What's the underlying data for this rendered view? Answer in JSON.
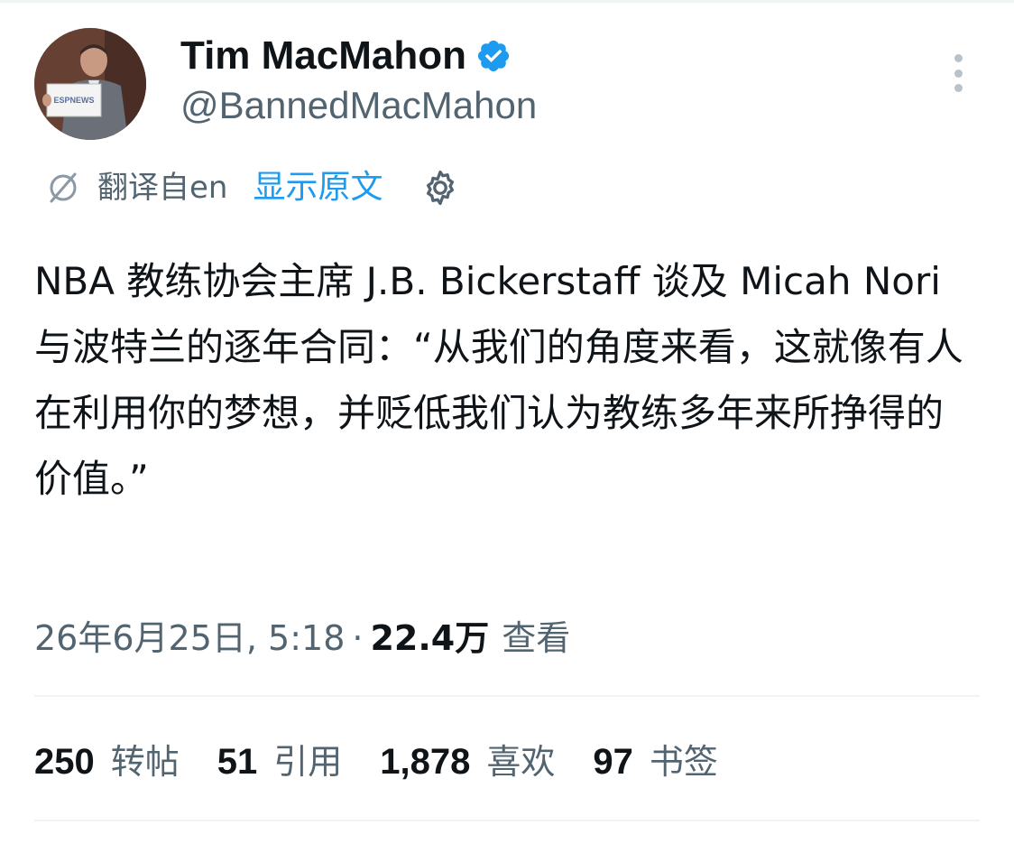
{
  "author": {
    "display_name": "Tim MacMahon",
    "handle": "@BannedMacMahon",
    "verified": true,
    "avatar_sign_text": "ESPNEWS"
  },
  "translation": {
    "label": "翻译自en",
    "show_original": "显示原文"
  },
  "tweet": {
    "text": "NBA 教练协会主席 J.B. Bickerstaff 谈及 Micah Nori 与波特兰的逐年合同：“从我们的角度来看，这就像有人在利用你的梦想，并贬低我们认为教练多年来所挣得的价值。”"
  },
  "meta": {
    "date": "26年6月25日, 5:18",
    "separator": "·",
    "views_count": "22.4万",
    "views_label": "查看"
  },
  "stats": [
    {
      "count": "250",
      "label": "转帖"
    },
    {
      "count": "51",
      "label": "引用"
    },
    {
      "count": "1,878",
      "label": "喜欢"
    },
    {
      "count": "97",
      "label": "书签"
    }
  ],
  "colors": {
    "accent": "#1d9bf0",
    "text_primary": "#0f1419",
    "text_secondary": "#536471",
    "divider": "#eff3f4"
  },
  "icons": {
    "verified": "verified-badge-icon",
    "more": "more-vertical-icon",
    "translate": "translate-icon",
    "settings": "gear-icon"
  }
}
